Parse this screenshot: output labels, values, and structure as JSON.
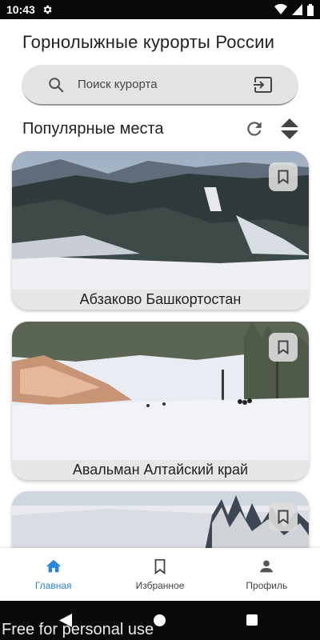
{
  "status_bar": {
    "time": "10:43",
    "icons": [
      "gear-icon",
      "wifi-icon",
      "signal-icon",
      "battery-icon"
    ]
  },
  "app": {
    "title": "Горнолыжные курорты России"
  },
  "search": {
    "placeholder": "Поиск курорта",
    "value": ""
  },
  "section": {
    "title": "Популярные места",
    "actions": [
      "refresh-icon",
      "sort-icon"
    ]
  },
  "cards": [
    {
      "caption": "Абзаково Башкортостан",
      "icon": "bookmark-icon"
    },
    {
      "caption": "Авальман  Алтайский край",
      "icon": "bookmark-icon"
    },
    {
      "caption": "",
      "icon": "bookmark-icon"
    }
  ],
  "bottom_nav": {
    "items": [
      {
        "label": "Главная",
        "icon": "home-icon",
        "active": true
      },
      {
        "label": "Избранное",
        "icon": "bookmark-icon",
        "active": false
      },
      {
        "label": "Профиль",
        "icon": "person-icon",
        "active": false
      }
    ]
  },
  "watermark": "Free for personal use",
  "colors": {
    "accent": "#2a86d9",
    "search_bg": "#e4e4e4"
  }
}
